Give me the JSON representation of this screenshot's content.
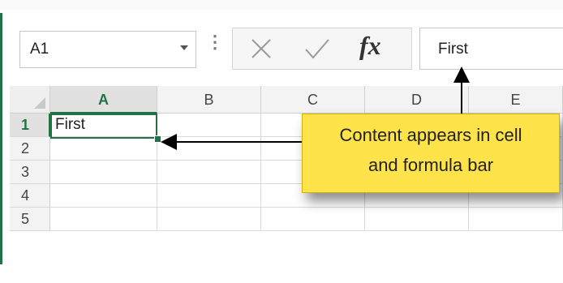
{
  "name_box": {
    "value": "A1"
  },
  "formula_bar": {
    "value": "First"
  },
  "formula_buttons": {
    "fx_label": "fx"
  },
  "columns": [
    "A",
    "B",
    "C",
    "D",
    "E"
  ],
  "rows": [
    "1",
    "2",
    "3",
    "4",
    "5"
  ],
  "cells": {
    "A1": "First"
  },
  "callout": {
    "line1": "Content appears in cell",
    "line2": "and formula bar"
  },
  "colors": {
    "accent": "#217346",
    "callout": "#ffe34a"
  }
}
